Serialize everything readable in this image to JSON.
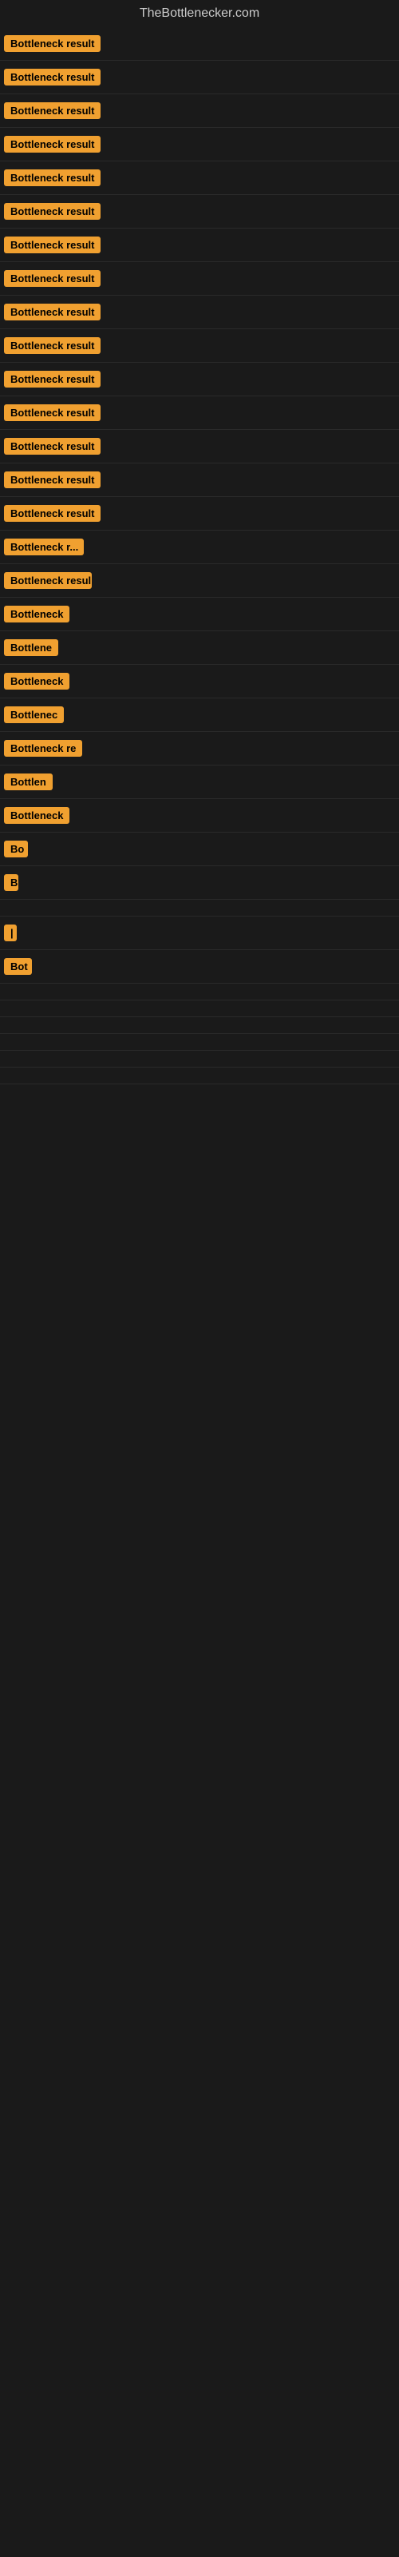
{
  "site": {
    "title": "TheBottlenecker.com"
  },
  "rows": [
    {
      "label": "Bottleneck result",
      "width": 130
    },
    {
      "label": "Bottleneck result",
      "width": 130
    },
    {
      "label": "Bottleneck result",
      "width": 130
    },
    {
      "label": "Bottleneck result",
      "width": 130
    },
    {
      "label": "Bottleneck result",
      "width": 130
    },
    {
      "label": "Bottleneck result",
      "width": 130
    },
    {
      "label": "Bottleneck result",
      "width": 130
    },
    {
      "label": "Bottleneck result",
      "width": 130
    },
    {
      "label": "Bottleneck result",
      "width": 130
    },
    {
      "label": "Bottleneck result",
      "width": 130
    },
    {
      "label": "Bottleneck result",
      "width": 130
    },
    {
      "label": "Bottleneck result",
      "width": 130
    },
    {
      "label": "Bottleneck result",
      "width": 130
    },
    {
      "label": "Bottleneck result",
      "width": 130
    },
    {
      "label": "Bottleneck result",
      "width": 130
    },
    {
      "label": "Bottleneck r...",
      "width": 100
    },
    {
      "label": "Bottleneck resul",
      "width": 110
    },
    {
      "label": "Bottleneck",
      "width": 85
    },
    {
      "label": "Bottlene",
      "width": 70
    },
    {
      "label": "Bottleneck",
      "width": 85
    },
    {
      "label": "Bottlenec",
      "width": 78
    },
    {
      "label": "Bottleneck re",
      "width": 100
    },
    {
      "label": "Bottlen",
      "width": 65
    },
    {
      "label": "Bottleneck",
      "width": 85
    },
    {
      "label": "Bo",
      "width": 30
    },
    {
      "label": "B",
      "width": 18
    },
    {
      "label": "",
      "width": 10
    },
    {
      "label": "|",
      "width": 8
    },
    {
      "label": "Bot",
      "width": 35
    },
    {
      "label": "",
      "width": 0
    },
    {
      "label": "",
      "width": 0
    },
    {
      "label": "",
      "width": 0
    },
    {
      "label": "",
      "width": 0
    },
    {
      "label": "",
      "width": 0
    },
    {
      "label": "",
      "width": 0
    }
  ]
}
